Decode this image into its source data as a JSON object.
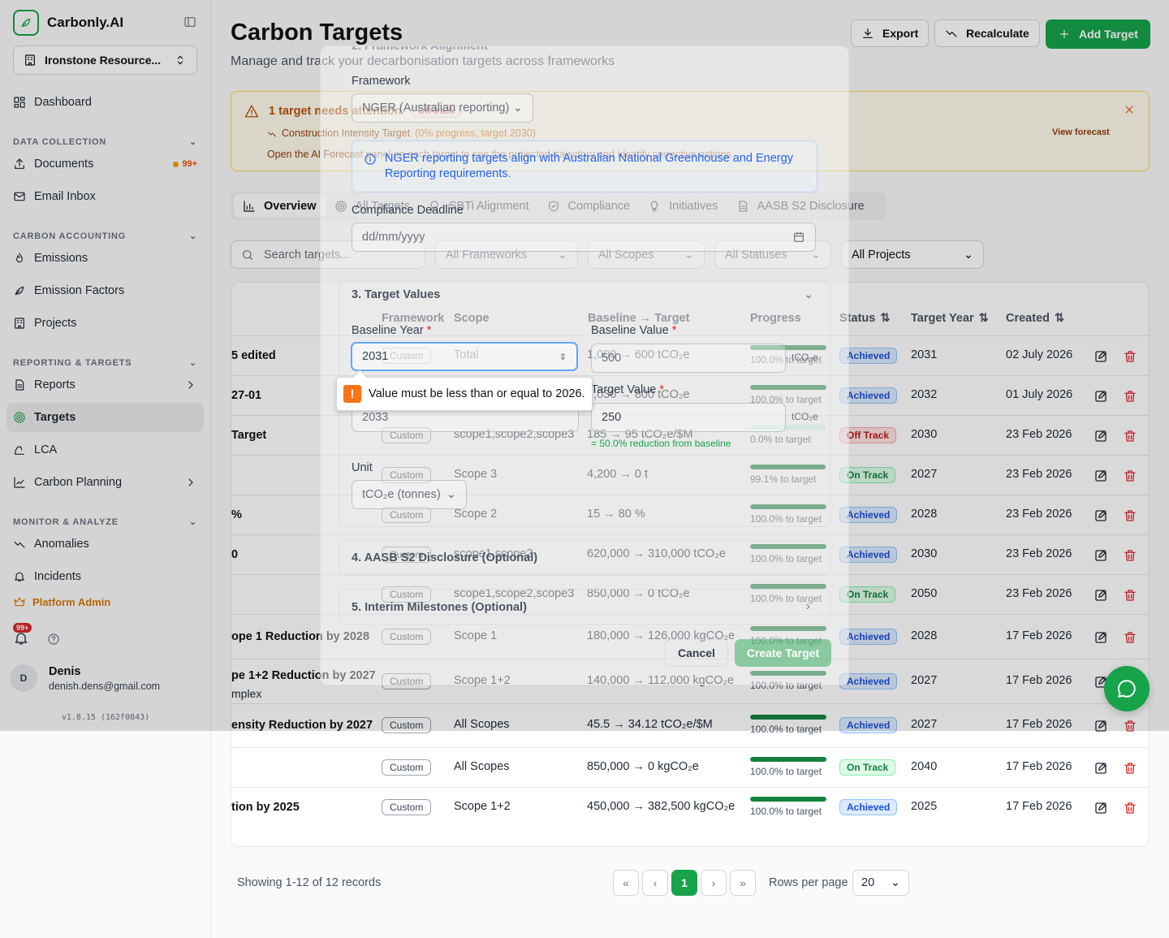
{
  "app": {
    "name": "Carbonly.AI",
    "org": "Ironstone Resource...",
    "version": "v1.8.15 (162f0843)"
  },
  "nav": {
    "dashboard": "Dashboard",
    "sec_data": "DATA COLLECTION",
    "documents": "Documents",
    "documents_badge": "99+",
    "email": "Email Inbox",
    "sec_carbon": "CARBON ACCOUNTING",
    "emissions": "Emissions",
    "factors": "Emission Factors",
    "projects": "Projects",
    "sec_reporting": "REPORTING & TARGETS",
    "reports": "Reports",
    "targets": "Targets",
    "lca": "LCA",
    "planning": "Carbon Planning",
    "sec_monitor": "MONITOR & ANALYZE",
    "anomalies": "Anomalies",
    "incidents": "Incidents",
    "platform_admin": "Platform Admin",
    "notif_badge": "99+"
  },
  "user": {
    "initial": "D",
    "name": "Denis",
    "email": "denish.dens@gmail.com"
  },
  "header": {
    "title": "Carbon Targets",
    "subtitle": "Manage and track your decarbonisation targets across frameworks",
    "export": "Export",
    "recalculate": "Recalculate",
    "add": "Add Target"
  },
  "alert": {
    "title": "1 target needs attention",
    "pill": "Off-track",
    "item_name": "Construction Intensity Target",
    "item_meta": "(0% progress, target 2030)",
    "view": "View forecast",
    "footer": "Open the AI Forecast panel on each target to see the projected trajectory and identify corrective actions."
  },
  "tabs": [
    "Overview",
    "All Targets",
    "SBTi Alignment",
    "Compliance",
    "Initiatives",
    "AASB S2 Disclosure"
  ],
  "filters": {
    "search_placeholder": "Search targets...",
    "frameworks": "All Frameworks",
    "scopes": "All Scopes",
    "statuses": "All Statuses",
    "projects": "All Projects"
  },
  "columns": {
    "framework": "Framework",
    "scope": "Scope",
    "values": "Baseline → Target",
    "progress": "Progress",
    "status": "Status",
    "year": "Target Year",
    "created": "Created"
  },
  "rows": [
    {
      "name": "5 edited",
      "sub": "",
      "fw": "Custom",
      "scope": "Total",
      "values": "1,000 → 600 tCO₂e",
      "progress": 1.0,
      "plabel": "100.0% to target",
      "status": "Achieved",
      "year": "2031",
      "created": "02 July 2026"
    },
    {
      "name": "27-01",
      "sub": "",
      "fw": "Custom",
      "scope": "",
      "values": "1,030 → 800 tCO₂e",
      "progress": 1.0,
      "plabel": "100.0% to target",
      "status": "Achieved",
      "year": "2032",
      "created": "01 July 2026"
    },
    {
      "name": "Target",
      "sub": "",
      "fw": "Custom",
      "scope": "scope1,scope2,scope3",
      "values": "185 → 95 tCO₂e/$M",
      "progress": 0.0,
      "plabel": "0.0% to target",
      "status": "Off Track",
      "year": "2030",
      "created": "23 Feb 2026"
    },
    {
      "name": "",
      "sub": "",
      "fw": "Custom",
      "scope": "Scope 3",
      "values": "4,200 → 0 t",
      "progress": 0.991,
      "plabel": "99.1% to target",
      "status": "On Track",
      "year": "2027",
      "created": "23 Feb 2026"
    },
    {
      "name": "%",
      "sub": "",
      "fw": "Custom",
      "scope": "Scope 2",
      "values": "15 → 80 %",
      "progress": 1.0,
      "plabel": "100.0% to target",
      "status": "Achieved",
      "year": "2028",
      "created": "23 Feb 2026"
    },
    {
      "name": "0",
      "sub": "",
      "fw": "Custom",
      "scope": "scope1,scope2",
      "values": "620,000 → 310,000 tCO₂e",
      "progress": 1.0,
      "plabel": "100.0% to target",
      "status": "Achieved",
      "year": "2030",
      "created": "23 Feb 2026"
    },
    {
      "name": "",
      "sub": "",
      "fw": "Custom",
      "scope": "scope1,scope2,scope3",
      "values": "850,000 → 0 tCO₂e",
      "progress": 1.0,
      "plabel": "100.0% to target",
      "status": "On Track",
      "year": "2050",
      "created": "23 Feb 2026"
    },
    {
      "name": "ope 1 Reduction by 2028",
      "sub": "",
      "fw": "Custom",
      "scope": "Scope 1",
      "values": "180,000 → 126,000 kgCO₂e",
      "progress": 1.0,
      "plabel": "100.0% to target",
      "status": "Achieved",
      "year": "2028",
      "created": "17 Feb 2026"
    },
    {
      "name": "pe 1+2 Reduction by 2027",
      "sub": "mplex",
      "fw": "Custom",
      "scope": "Scope 1+2",
      "values": "140,000 → 112,000 kgCO₂e",
      "progress": 1.0,
      "plabel": "100.0% to target",
      "status": "Achieved",
      "year": "2027",
      "created": "17 Feb 2026"
    },
    {
      "name": "ensity Reduction by 2027",
      "sub": "",
      "fw": "Custom",
      "scope": "All Scopes",
      "values": "45.5 → 34.12 tCO₂e/$M",
      "progress": 1.0,
      "plabel": "100.0% to target",
      "status": "Achieved",
      "year": "2027",
      "created": "17 Feb 2026"
    },
    {
      "name": "",
      "sub": "",
      "fw": "Custom",
      "scope": "All Scopes",
      "values": "850,000 → 0 kgCO₂e",
      "progress": 1.0,
      "plabel": "100.0% to target",
      "status": "On Track",
      "year": "2040",
      "created": "17 Feb 2026"
    },
    {
      "name": "tion by 2025",
      "sub": "",
      "fw": "Custom",
      "scope": "Scope 1+2",
      "values": "450,000 → 382,500 kgCO₂e",
      "progress": 1.0,
      "plabel": "100.0% to target",
      "status": "Achieved",
      "year": "2025",
      "created": "17 Feb 2026"
    }
  ],
  "pagination": {
    "showing": "Showing 1-12 of 12 records",
    "page": "1",
    "rows_label": "Rows per page",
    "rows_value": "20"
  },
  "modal": {
    "sec2_title": "2. Framework Alignment",
    "framework_label": "Framework",
    "framework_value": "NGER (Australian reporting)",
    "info": "NGER reporting targets align with Australian National Greenhouse and Energy Reporting requirements.",
    "deadline_label": "Compliance Deadline",
    "deadline_placeholder": "dd/mm/yyyy",
    "sec3_title": "3. Target Values",
    "baseline_year_label": "Baseline Year",
    "baseline_year_value": "2031",
    "baseline_value_label": "Baseline Value",
    "baseline_value": "500",
    "baseline_unit": "tCO₂e",
    "target_year_value": "2033",
    "target_value_label": "Target Value",
    "target_value": "250",
    "target_unit": "tCO₂e",
    "reduction_note": "= 50.0% reduction from baseline",
    "unit_label": "Unit",
    "unit_value": "tCO₂e (tonnes)",
    "sec4_title": "4. AASB S2 Disclosure (Optional)",
    "sec5_title": "5. Interim Milestones (Optional)",
    "cancel": "Cancel",
    "create": "Create Target",
    "validation": "Value must be less than or equal to 2026."
  }
}
